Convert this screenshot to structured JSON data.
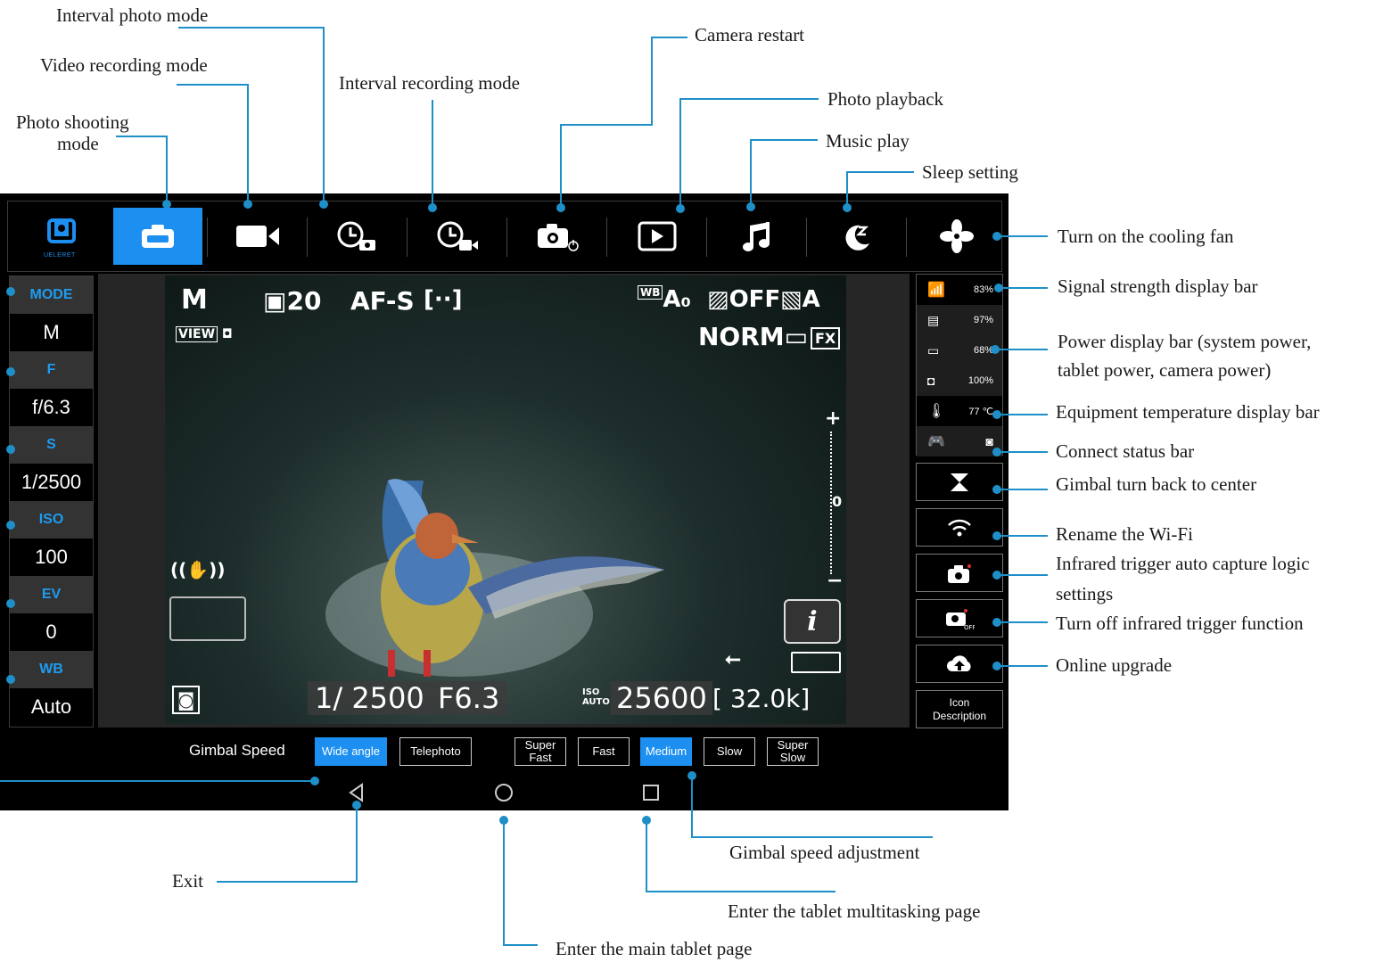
{
  "annotations": {
    "interval_photo_mode": "Interval photo mode",
    "video_recording_mode": "Video recording mode",
    "interval_recording_mode": "Interval recording mode",
    "photo_shooting_mode_1": "Photo shooting",
    "photo_shooting_mode_2": "mode",
    "camera_restart": "Camera restart",
    "photo_playback": "Photo playback",
    "music_play": "Music play",
    "sleep_setting": "Sleep setting",
    "cooling_fan": "Turn on the cooling fan",
    "signal_strength": "Signal strength display bar",
    "power_display_1": "Power display bar (system power,",
    "power_display_2": "tablet power, camera power)",
    "equipment_temperature": "Equipment temperature display bar",
    "connect_status": "Connect status bar",
    "gimbal_center": "Gimbal turn back to center",
    "rename_wifi": "Rename the Wi-Fi",
    "infrared_auto_1": "Infrared trigger auto capture logic",
    "infrared_auto_2": "settings",
    "infrared_off": "Turn off infrared trigger function",
    "online_upgrade": "Online upgrade",
    "gimbal_speed_adjustment": "Gimbal speed adjustment",
    "exit": "Exit",
    "multitasking": "Enter the tablet multitasking page",
    "main_page": "Enter the main tablet page"
  },
  "toolbar": {
    "logo_text": "UELERET",
    "items": [
      "logo-icon",
      "photo-mode-icon",
      "video-mode-icon",
      "interval-photo-icon",
      "interval-video-icon",
      "camera-restart-icon",
      "playback-icon",
      "music-icon",
      "sleep-icon",
      "fan-icon"
    ],
    "active_color": "#1c8ff0"
  },
  "settings": [
    {
      "label": "MODE",
      "value": "M"
    },
    {
      "label": "F",
      "value": "f/6.3"
    },
    {
      "label": "S",
      "value": "1/2500"
    },
    {
      "label": "ISO",
      "value": "100"
    },
    {
      "label": "EV",
      "value": "0"
    },
    {
      "label": "WB",
      "value": "Auto"
    }
  ],
  "viewfinder": {
    "mode": "M",
    "burst": "20",
    "af": "AF-S",
    "focus_area": "[··]",
    "wb": "A₀",
    "off": "OFF",
    "picture_ctl": "A",
    "view": "VIEW",
    "quality": "NORM",
    "format": "FX",
    "shutter": "1/ 2500",
    "aperture": "F6.3",
    "iso_prefix": "ISO AUTO",
    "iso": "25600",
    "frames": "[ 32.0k]",
    "plus": "+",
    "minus": "−",
    "zero": "0",
    "info": "i"
  },
  "status": {
    "signal": "83%",
    "system_power": "97%",
    "tablet_power": "68%",
    "camera_power": "100%",
    "temperature": "77 ℃"
  },
  "right_buttons": {
    "icon_description_1": "Icon",
    "icon_description_2": "Description"
  },
  "gimbal": {
    "label": "Gimbal Speed",
    "lens_options": [
      {
        "label": "Wide angle",
        "active": true
      },
      {
        "label": "Telephoto",
        "active": false
      }
    ],
    "speed_options": [
      {
        "label": "Super Fast",
        "active": false
      },
      {
        "label": "Fast",
        "active": false
      },
      {
        "label": "Medium",
        "active": true
      },
      {
        "label": "Slow",
        "active": false
      },
      {
        "label": "Super Slow",
        "active": false
      }
    ]
  },
  "nav": [
    "back-icon",
    "home-icon",
    "recents-icon"
  ]
}
